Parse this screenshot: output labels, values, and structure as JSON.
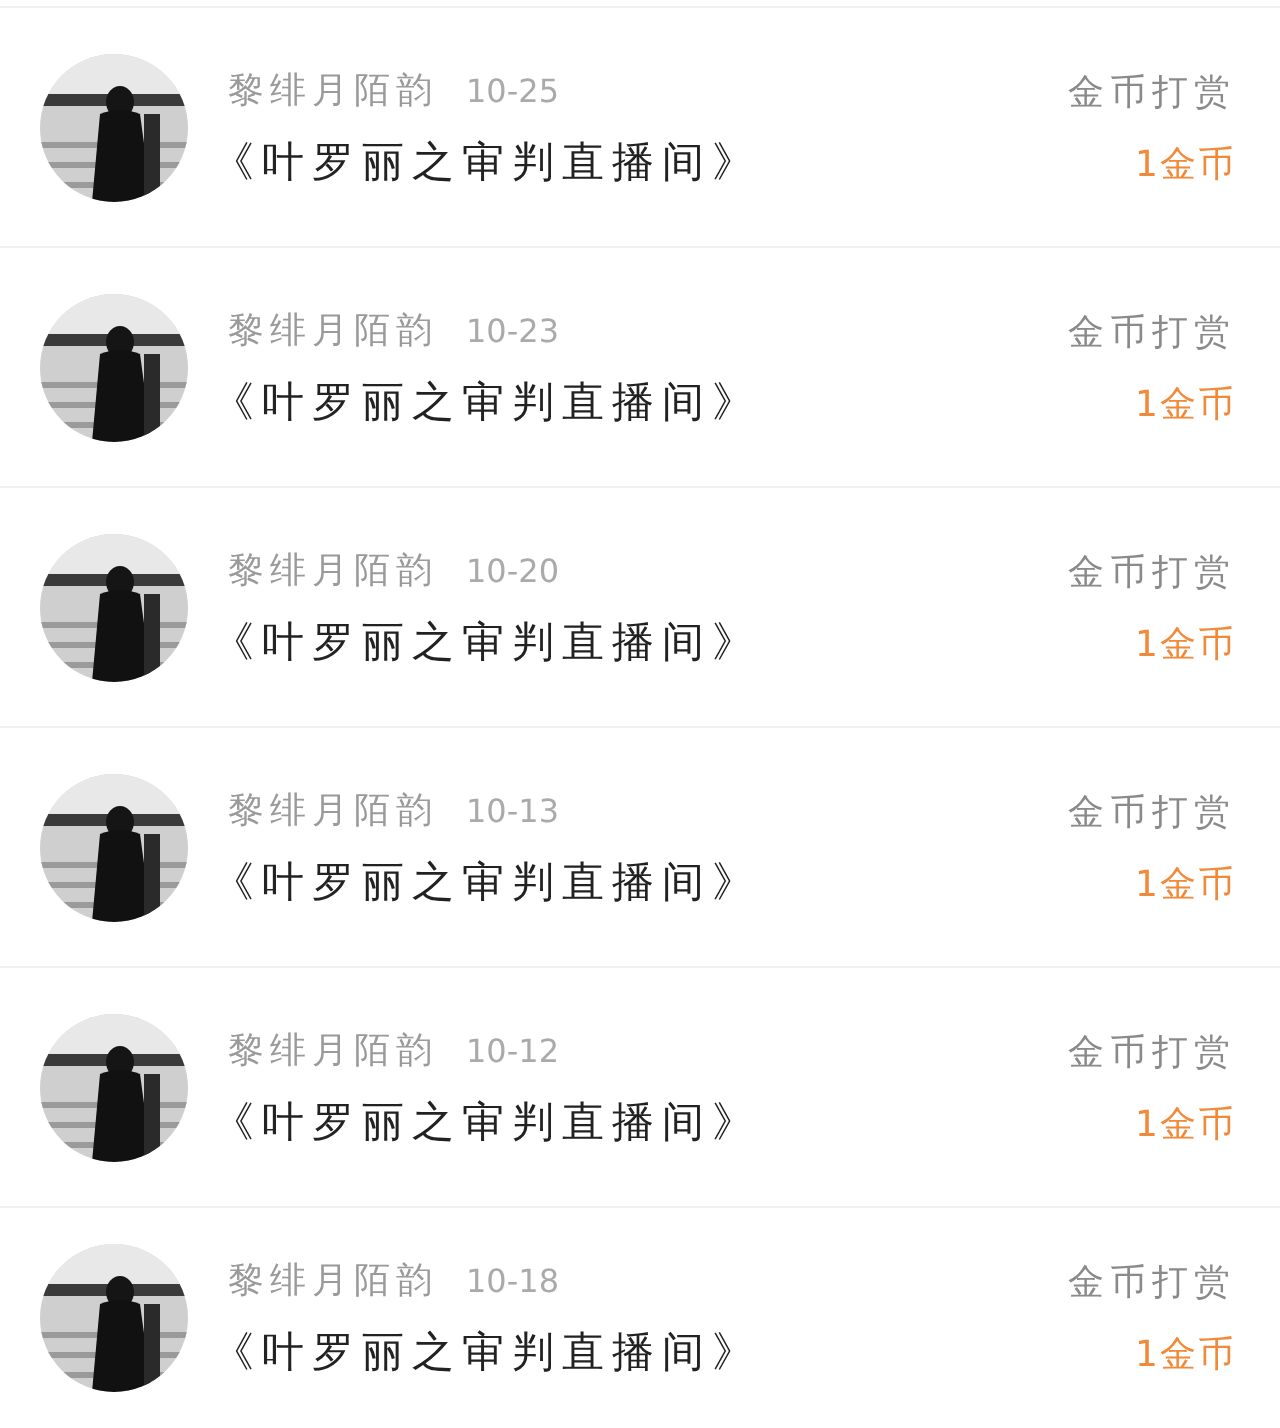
{
  "rows": [
    {
      "name": "黎绯月陌韵",
      "date": "10-25",
      "title": "《叶罗丽之审判直播间》",
      "type": "金币打赏",
      "amount": "1金币"
    },
    {
      "name": "黎绯月陌韵",
      "date": "10-23",
      "title": "《叶罗丽之审判直播间》",
      "type": "金币打赏",
      "amount": "1金币"
    },
    {
      "name": "黎绯月陌韵",
      "date": "10-20",
      "title": "《叶罗丽之审判直播间》",
      "type": "金币打赏",
      "amount": "1金币"
    },
    {
      "name": "黎绯月陌韵",
      "date": "10-13",
      "title": "《叶罗丽之审判直播间》",
      "type": "金币打赏",
      "amount": "1金币"
    },
    {
      "name": "黎绯月陌韵",
      "date": "10-12",
      "title": "《叶罗丽之审判直播间》",
      "type": "金币打赏",
      "amount": "1金币"
    },
    {
      "name": "黎绯月陌韵",
      "date": "10-18",
      "title": "《叶罗丽之审判直播间》",
      "type": "金币打赏",
      "amount": "1金币"
    }
  ]
}
